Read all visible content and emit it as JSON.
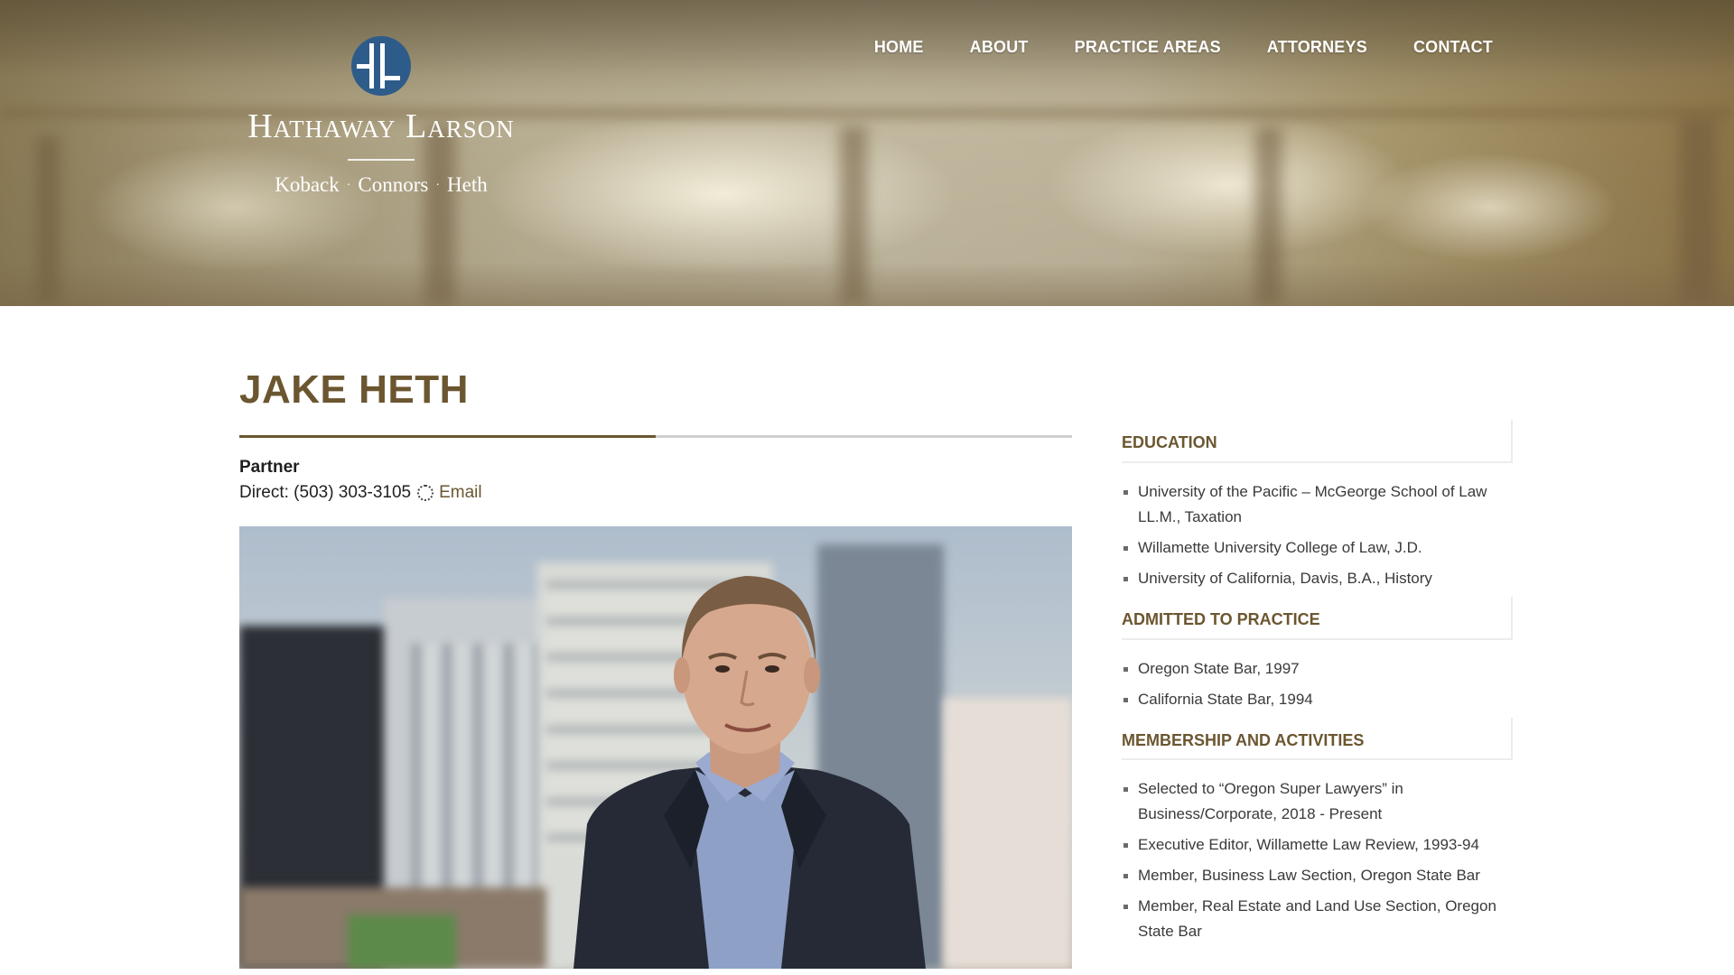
{
  "header": {
    "logo": {
      "name": "Hathaway Larson",
      "partners": [
        "Koback",
        "Connors",
        "Heth"
      ],
      "separator": "·",
      "mark_color": "#2e5c8a"
    },
    "nav": [
      "HOME",
      "ABOUT",
      "PRACTICE AREAS",
      "ATTORNEYS",
      "CONTACT"
    ]
  },
  "profile": {
    "name": "JAKE HETH",
    "title": "Partner",
    "direct_label": "Direct: (503) 303-3105",
    "email_label": "Email"
  },
  "sidebar": {
    "sections": [
      {
        "title": "EDUCATION",
        "items": [
          "University of the Pacific – McGeorge School of Law LL.M., Taxation",
          "Willamette University College of Law, J.D.",
          "University of California, Davis, B.A., History"
        ]
      },
      {
        "title": "ADMITTED TO PRACTICE",
        "items": [
          "Oregon State Bar, 1997",
          "California State Bar, 1994"
        ]
      },
      {
        "title": "MEMBERSHIP AND ACTIVITIES",
        "items": [
          "Selected to “Oregon Super Lawyers” in Business/Corporate, 2018 - Present",
          "Executive Editor, Willamette Law Review, 1993-94",
          "Member, Business Law Section, Oregon State Bar",
          "Member, Real Estate and Land Use Section, Oregon State Bar"
        ]
      }
    ]
  },
  "colors": {
    "accent": "#6b5630",
    "divider": "#cfcfcf",
    "text": "#1f1f1f"
  }
}
